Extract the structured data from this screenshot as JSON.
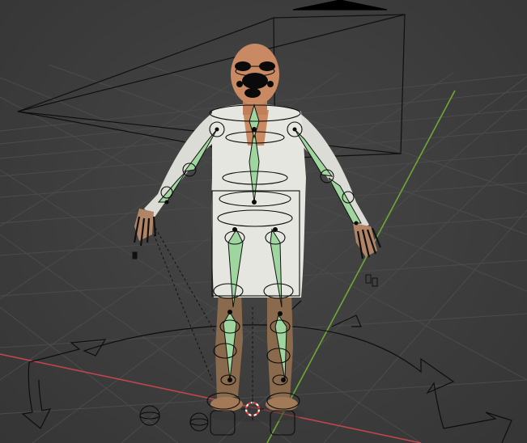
{
  "viewport": {
    "name": "3D Viewport",
    "colors": {
      "background": "#3d3d3d",
      "grid": "#4b4b4b",
      "x_axis": "#c0454f",
      "y_axis": "#6fa834",
      "bone_fill": "#9fd6a0",
      "bone_outline": "#111111",
      "skin": "#c98a63",
      "shirt": "#e4e4de",
      "trousers": "#8a6a4c",
      "cursor_red": "#e0443a"
    },
    "objects": [
      "camera",
      "character-mesh",
      "armature",
      "rig-controls",
      "3d-cursor"
    ]
  }
}
